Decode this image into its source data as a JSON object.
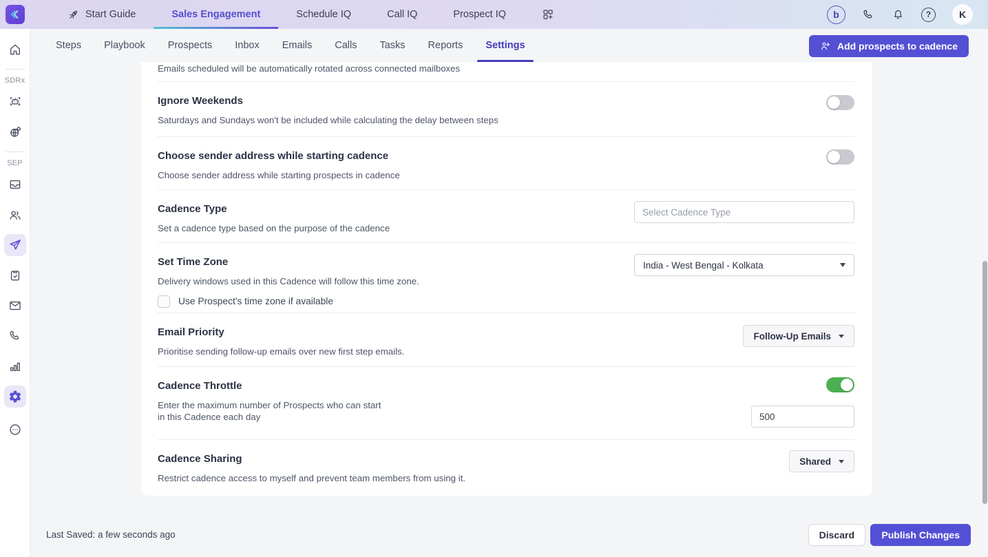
{
  "colors": {
    "accent": "#5450d6",
    "active_tab": "#443dbb",
    "toggle_on": "#4cb052",
    "toggle_off": "#c9c9cf",
    "topnav_gradient": [
      "#dcd6f0",
      "#d7e7f2"
    ],
    "active_underline_gradient": [
      "#56c0cf",
      "#6a4fd8"
    ]
  },
  "topnav": {
    "logo_icon": "klenty-chevron-logo",
    "items": [
      {
        "label": "Start Guide",
        "icon": "rocket-icon",
        "active": false
      },
      {
        "label": "Sales Engagement",
        "active": true
      },
      {
        "label": "Schedule IQ",
        "active": false
      },
      {
        "label": "Call IQ",
        "active": false
      },
      {
        "label": "Prospect IQ",
        "active": false
      }
    ],
    "apps_icon": "apps-grid-plus-icon",
    "right_icons": [
      "b-badge-icon",
      "phone-icon",
      "bell-icon",
      "help-icon"
    ],
    "b_badge_glyph": "b",
    "help_glyph": "?",
    "avatar_initial": "K"
  },
  "subnav": {
    "tabs": [
      {
        "label": "Steps",
        "active": false
      },
      {
        "label": "Playbook",
        "active": false
      },
      {
        "label": "Prospects",
        "active": false
      },
      {
        "label": "Inbox",
        "active": false
      },
      {
        "label": "Emails",
        "active": false
      },
      {
        "label": "Calls",
        "active": false
      },
      {
        "label": "Tasks",
        "active": false
      },
      {
        "label": "Reports",
        "active": false
      },
      {
        "label": "Settings",
        "active": true
      }
    ],
    "add_button": {
      "label": "Add prospects to cadence",
      "icon": "person-plus-icon"
    }
  },
  "sidebar": {
    "groups": [
      {
        "label": "",
        "items": [
          {
            "icon": "home-icon",
            "active": false
          }
        ]
      },
      {
        "label": "SDRx",
        "items": [
          {
            "icon": "bot-icon",
            "active": false
          },
          {
            "icon": "globe-gear-icon",
            "active": false
          }
        ]
      },
      {
        "label": "SEP",
        "items": [
          {
            "icon": "inbox-tray-icon",
            "active": false
          },
          {
            "icon": "people-icon",
            "active": false
          },
          {
            "icon": "paper-plane-icon",
            "active": true
          },
          {
            "icon": "clipboard-check-icon",
            "active": false
          },
          {
            "icon": "envelope-icon",
            "active": false
          },
          {
            "icon": "phone-icon",
            "active": false
          },
          {
            "icon": "bar-chart-icon",
            "active": false
          },
          {
            "icon": "gear-icon",
            "active": true
          },
          {
            "icon": "more-circle-icon",
            "active": false
          }
        ]
      }
    ]
  },
  "settings": {
    "rows": [
      {
        "id": "mailbox-rotation-helper",
        "text": "Emails scheduled will be automatically rotated across connected mailboxes"
      },
      {
        "id": "ignore-weekends",
        "title": "Ignore Weekends",
        "description": "Saturdays and Sundays won't be included while calculating the delay between steps",
        "control": "toggle",
        "state": "off"
      },
      {
        "id": "choose-sender-address",
        "title": "Choose sender address while starting cadence",
        "description": "Choose sender address while starting prospects in cadence",
        "control": "toggle",
        "state": "off"
      },
      {
        "id": "cadence-type",
        "title": "Cadence Type",
        "description": "Set a cadence type based on the purpose of the cadence",
        "control": "text-input",
        "placeholder": "Select Cadence Type",
        "value": ""
      },
      {
        "id": "set-time-zone",
        "title": "Set Time Zone",
        "description": "Delivery windows used in this Cadence will follow this time zone.",
        "control": "select",
        "value": "India - West Bengal - Kolkata",
        "checkbox_label": "Use Prospect's time zone if available",
        "checkbox_checked": false
      },
      {
        "id": "email-priority",
        "title": "Email Priority",
        "description": "Prioritise sending follow-up emails over new first step emails.",
        "control": "dropdown",
        "value": "Follow-Up Emails"
      },
      {
        "id": "cadence-throttle",
        "title": "Cadence Throttle",
        "description": "Enter the maximum number of Prospects who can start in this Cadence each day",
        "control": "toggle-and-input",
        "state": "on",
        "value": "500"
      },
      {
        "id": "cadence-sharing",
        "title": "Cadence Sharing",
        "description": "Restrict cadence access to myself and prevent team members from using it.",
        "control": "dropdown",
        "value": "Shared"
      }
    ]
  },
  "footer": {
    "last_saved": "Last Saved: a few seconds ago",
    "discard_label": "Discard",
    "publish_label": "Publish Changes"
  }
}
